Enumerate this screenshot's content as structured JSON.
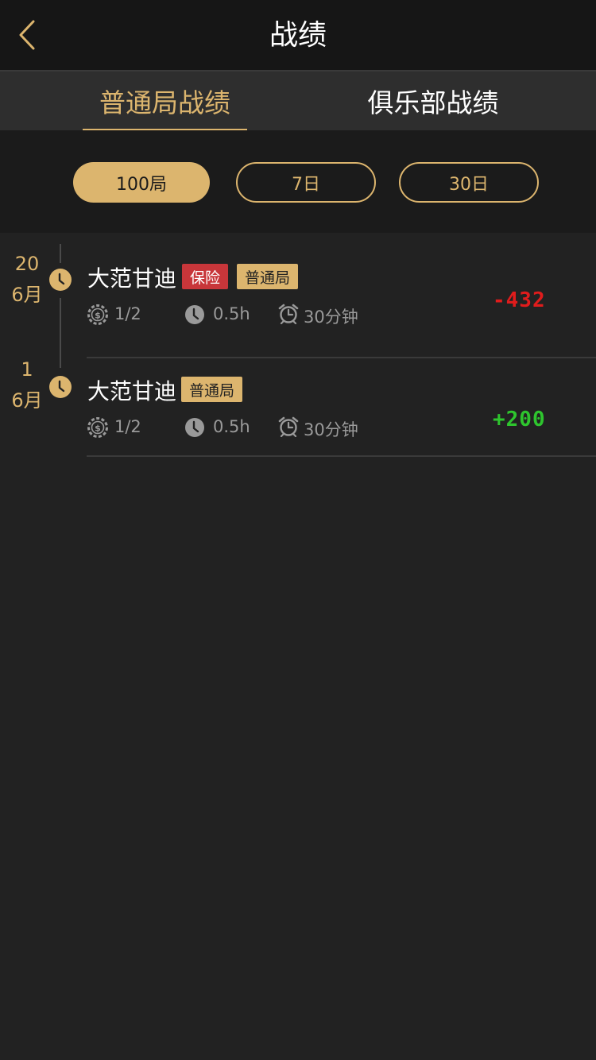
{
  "header": {
    "title": "战绩"
  },
  "tabs": [
    {
      "label": "普通局战绩"
    },
    {
      "label": "俱乐部战绩"
    }
  ],
  "filters": [
    {
      "label": "100局"
    },
    {
      "label": "7日"
    },
    {
      "label": "30日"
    }
  ],
  "records": [
    {
      "day": "20",
      "month": "6月",
      "name": "大范甘迪",
      "badges": [
        "保险",
        "普通局"
      ],
      "blinds": "1/2",
      "duration": "0.5h",
      "timer": "30分钟",
      "score": "-432"
    },
    {
      "day": "1",
      "month": "6月",
      "name": "大范甘迪",
      "badges": [
        "普通局"
      ],
      "blinds": "1/2",
      "duration": "0.5h",
      "timer": "30分钟",
      "score": "+200"
    }
  ],
  "colors": {
    "accent": "#dcb56e",
    "insurance_badge": "#c8363a",
    "loss": "#e01c1c",
    "win": "#2ec52e"
  },
  "icons": {
    "back": "chevron-left-icon",
    "timeline": "clock-icon",
    "blinds": "chip-icon",
    "duration": "clock-icon",
    "timer": "alarm-clock-icon"
  }
}
